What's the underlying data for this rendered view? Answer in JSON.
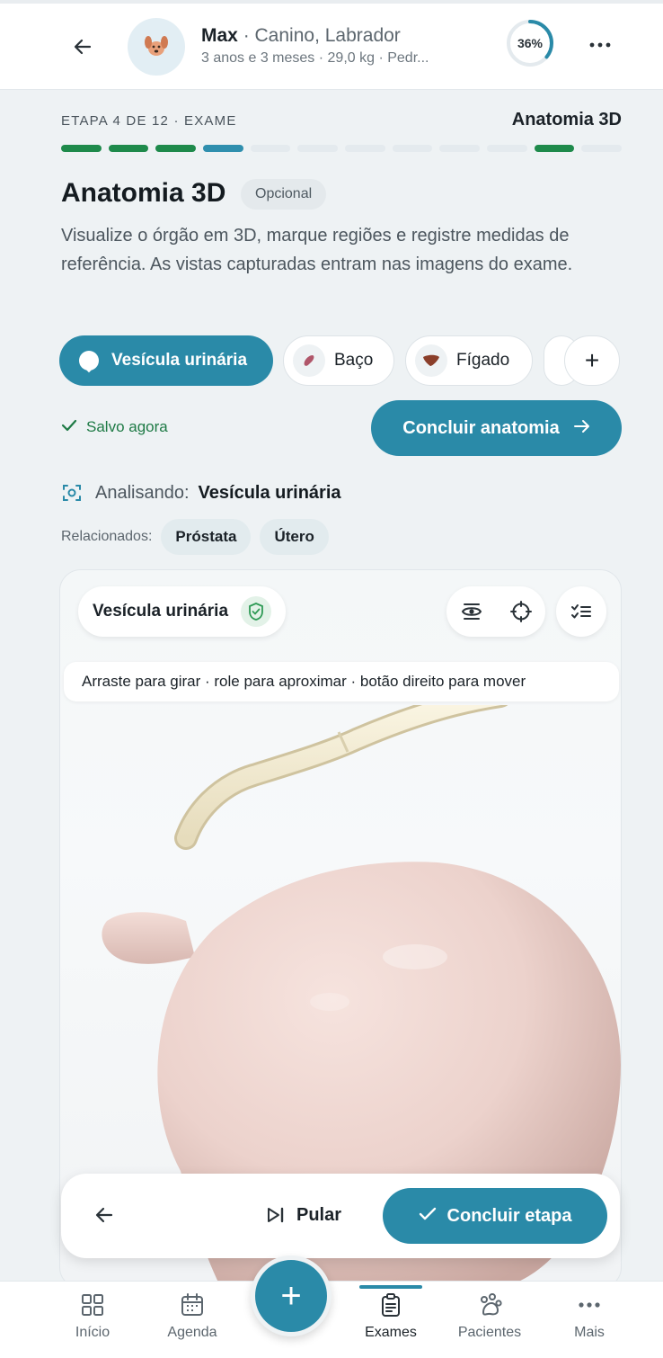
{
  "header": {
    "pet_name": "Max",
    "pet_breed": " · Canino, Labrador",
    "pet_meta": "3 anos e 3 meses · 29,0 kg · Pedr...",
    "progress_label": "36%",
    "progress_value": 0.36,
    "avatar_icon": "dog-icon"
  },
  "step": {
    "label": "ETAPA 4 DE 12 · EXAME",
    "name": "Anatomia 3D",
    "total": 12,
    "segments": [
      "done",
      "done",
      "done",
      "current",
      "pending",
      "pending",
      "pending",
      "pending",
      "pending",
      "pending",
      "done",
      "pending"
    ]
  },
  "page": {
    "title": "Anatomia 3D",
    "badge": "Opcional",
    "description": "Visualize o órgão em 3D, marque regiões e registre medidas de referência. As vistas capturadas entram nas imagens do exame."
  },
  "organs": {
    "active": "Vesícula urinária",
    "baco": "Baço",
    "figado": "Fígado",
    "add": "+"
  },
  "status": {
    "saved": "Salvo agora",
    "finish_anatomy": "Concluir anatomia"
  },
  "analysis": {
    "label": "Analisando:",
    "organ": "Vesícula urinária",
    "related_label": "Relacionados:",
    "related": [
      "Próstata",
      "Útero"
    ]
  },
  "viewer": {
    "title": "Vesícula urinária",
    "hint": "Arraste para girar · role para aproximar · botão direito para mover",
    "model_name": "bladder-3d-model"
  },
  "actions": {
    "skip": "Pular",
    "finish_step": "Concluir etapa"
  },
  "nav": {
    "inicio": "Início",
    "agenda": "Agenda",
    "exames": "Exames",
    "pacientes": "Pacientes",
    "mais": "Mais",
    "fab": "+"
  },
  "colors": {
    "accent": "#2a8aa8",
    "done": "#1e8a4b",
    "organ": "#ecd2cc"
  }
}
